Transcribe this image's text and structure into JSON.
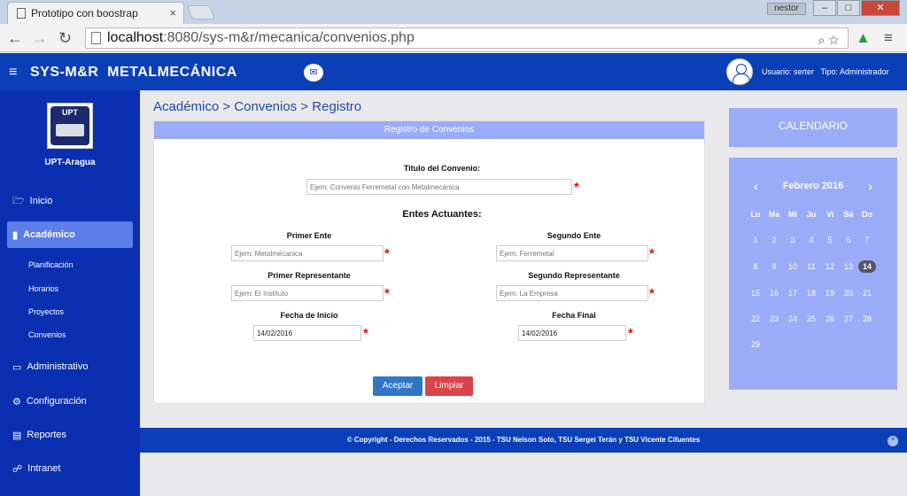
{
  "browser": {
    "tab_title": "Prototipo con boostrap",
    "tab_close": "×",
    "profile": "nestor",
    "win_min": "–",
    "win_max": "□",
    "win_close": "✕",
    "url_host": "localhost",
    "url_path": ":8080/sys-m&r/mecanica/convenios.php"
  },
  "header": {
    "menu_glyph": "≡",
    "brand": "SYS-M&R  METALMECÁNICA",
    "mail_glyph": "✉",
    "user_label": "Usuario: serter",
    "role_label": "Tipo: Administrador"
  },
  "sidebar": {
    "logo_text": "UPT",
    "org_name": "UPT-Aragua",
    "items": [
      {
        "label": "Inicio",
        "icon": "folder-icon",
        "glyph": "🗁"
      },
      {
        "label": "Académico",
        "icon": "book-icon",
        "glyph": "▮"
      },
      {
        "label": "Administrativo",
        "icon": "monitor-icon",
        "glyph": "▭"
      },
      {
        "label": "Configuración",
        "icon": "gears-icon",
        "glyph": "⚙"
      },
      {
        "label": "Reportes",
        "icon": "report-icon",
        "glyph": "▤"
      },
      {
        "label": "Intranet",
        "icon": "sitemap-icon",
        "glyph": "☍"
      }
    ],
    "subitems": [
      "Planificación",
      "Horarios",
      "Proyectos",
      "Convenios"
    ]
  },
  "breadcrumb": "Académico > Convenios > Registro",
  "form": {
    "header": "Registro de Convenios",
    "titulo_label": "Titulo del Convenio:",
    "titulo_placeholder": "Ejem: Convenio Ferremetal con Metalmecánica",
    "entes_label": "Entes Actuantes:",
    "primer_ente_label": "Primer Ente",
    "primer_ente_placeholder": "Ejem: Metalmécanica",
    "segundo_ente_label": "Segundo Ente",
    "segundo_ente_placeholder": "Ejem: Ferremetal",
    "primer_rep_label": "Primer Representante",
    "primer_rep_placeholder": "Ejem: El Instituto",
    "segundo_rep_label": "Segundo Representante",
    "segundo_rep_placeholder": "Ejem: La Empresa",
    "fecha_inicio_label": "Fecha de Inicio",
    "fecha_inicio_value": "14/02/2016",
    "fecha_final_label": "Fecha Final",
    "fecha_final_value": "14/02/2016",
    "required_mark": "*",
    "accept_label": "Aceptar",
    "clear_label": "Limpiar"
  },
  "footer": {
    "text": "© Copyright - Derechos Reservados - 2015 - TSU Nelson Soto, TSU Sergei Terán y TSU Vicente Cifuentes",
    "totop_glyph": "^"
  },
  "calendar": {
    "title": "CALENDARIO",
    "month": "Febrero 2016",
    "prev": "‹",
    "next": "›",
    "weekdays": [
      "Lu",
      "Ma",
      "Mi",
      "Ju",
      "Vi",
      "Sá",
      "Do"
    ],
    "days": [
      "1",
      "2",
      "3",
      "4",
      "5",
      "6",
      "7",
      "8",
      "9",
      "10",
      "11",
      "12",
      "13",
      "14",
      "15",
      "16",
      "17",
      "18",
      "19",
      "20",
      "21",
      "22",
      "23",
      "24",
      "25",
      "26",
      "27",
      "28",
      "29"
    ],
    "today": "14",
    "accent": "#556"
  },
  "colors": {
    "header_blue": "#0a3fb8",
    "sidebar_blue": "#0a2fb0",
    "panel_blue": "#9aabf7",
    "required_red": "#e0101a"
  }
}
